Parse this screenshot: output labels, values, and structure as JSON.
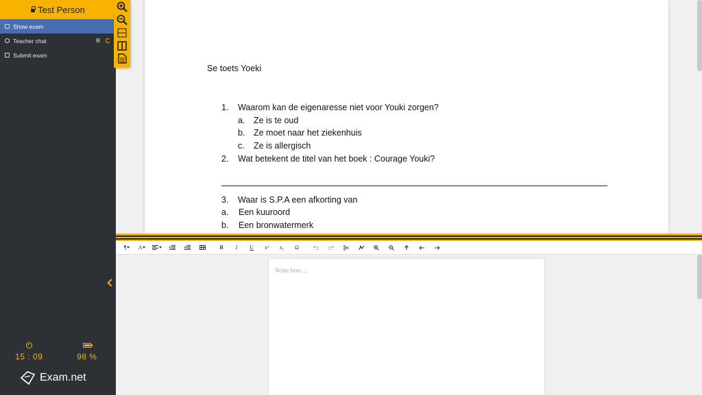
{
  "user": {
    "name": "Test Person"
  },
  "sidebar": {
    "items": [
      {
        "label": "Show exam",
        "active": true
      },
      {
        "label": "Teacher chat",
        "active": false
      },
      {
        "label": "Submit exam",
        "active": false
      }
    ]
  },
  "stats": {
    "time": "15 : 09",
    "battery": "98 %"
  },
  "brand": {
    "name": "Exam.net"
  },
  "tools": [
    {
      "icon": "zoom-in-icon"
    },
    {
      "icon": "zoom-out-icon"
    },
    {
      "icon": "horizontal-split-icon"
    },
    {
      "icon": "vertical-split-icon"
    },
    {
      "icon": "document-icon"
    }
  ],
  "document": {
    "title": "Se toets Yoeki",
    "q1": {
      "num": "1.",
      "text": "Waarom kan de eigenaresse niet voor Youki zorgen?"
    },
    "q1_options": [
      {
        "label": "a.",
        "text": "Ze is te oud"
      },
      {
        "label": "b.",
        "text": "Ze moet naar het ziekenhuis"
      },
      {
        "label": "c.",
        "text": "Ze is allergisch"
      }
    ],
    "q2": {
      "num": "2.",
      "text": "Wat betekent de titel van het boek : Courage Youki?"
    },
    "q3": {
      "num": "3.",
      "text": "Waar is S.P.A een afkorting van"
    },
    "q3_options": [
      {
        "label": "a.",
        "text": "Een kuuroord"
      },
      {
        "label": "b.",
        "text": "Een bronwatermerk"
      }
    ]
  },
  "editor": {
    "placeholder": "Write here ...",
    "toolbar": {
      "paragraph": "¶",
      "font": "A",
      "bold": "B",
      "italic": "I",
      "underline": "U",
      "superscript": "x²",
      "subscript": "x₂",
      "omega": "Ω"
    }
  },
  "colors": {
    "accent": "#f8b200",
    "sidebar": "#2d3035",
    "active": "#4a6db0"
  }
}
